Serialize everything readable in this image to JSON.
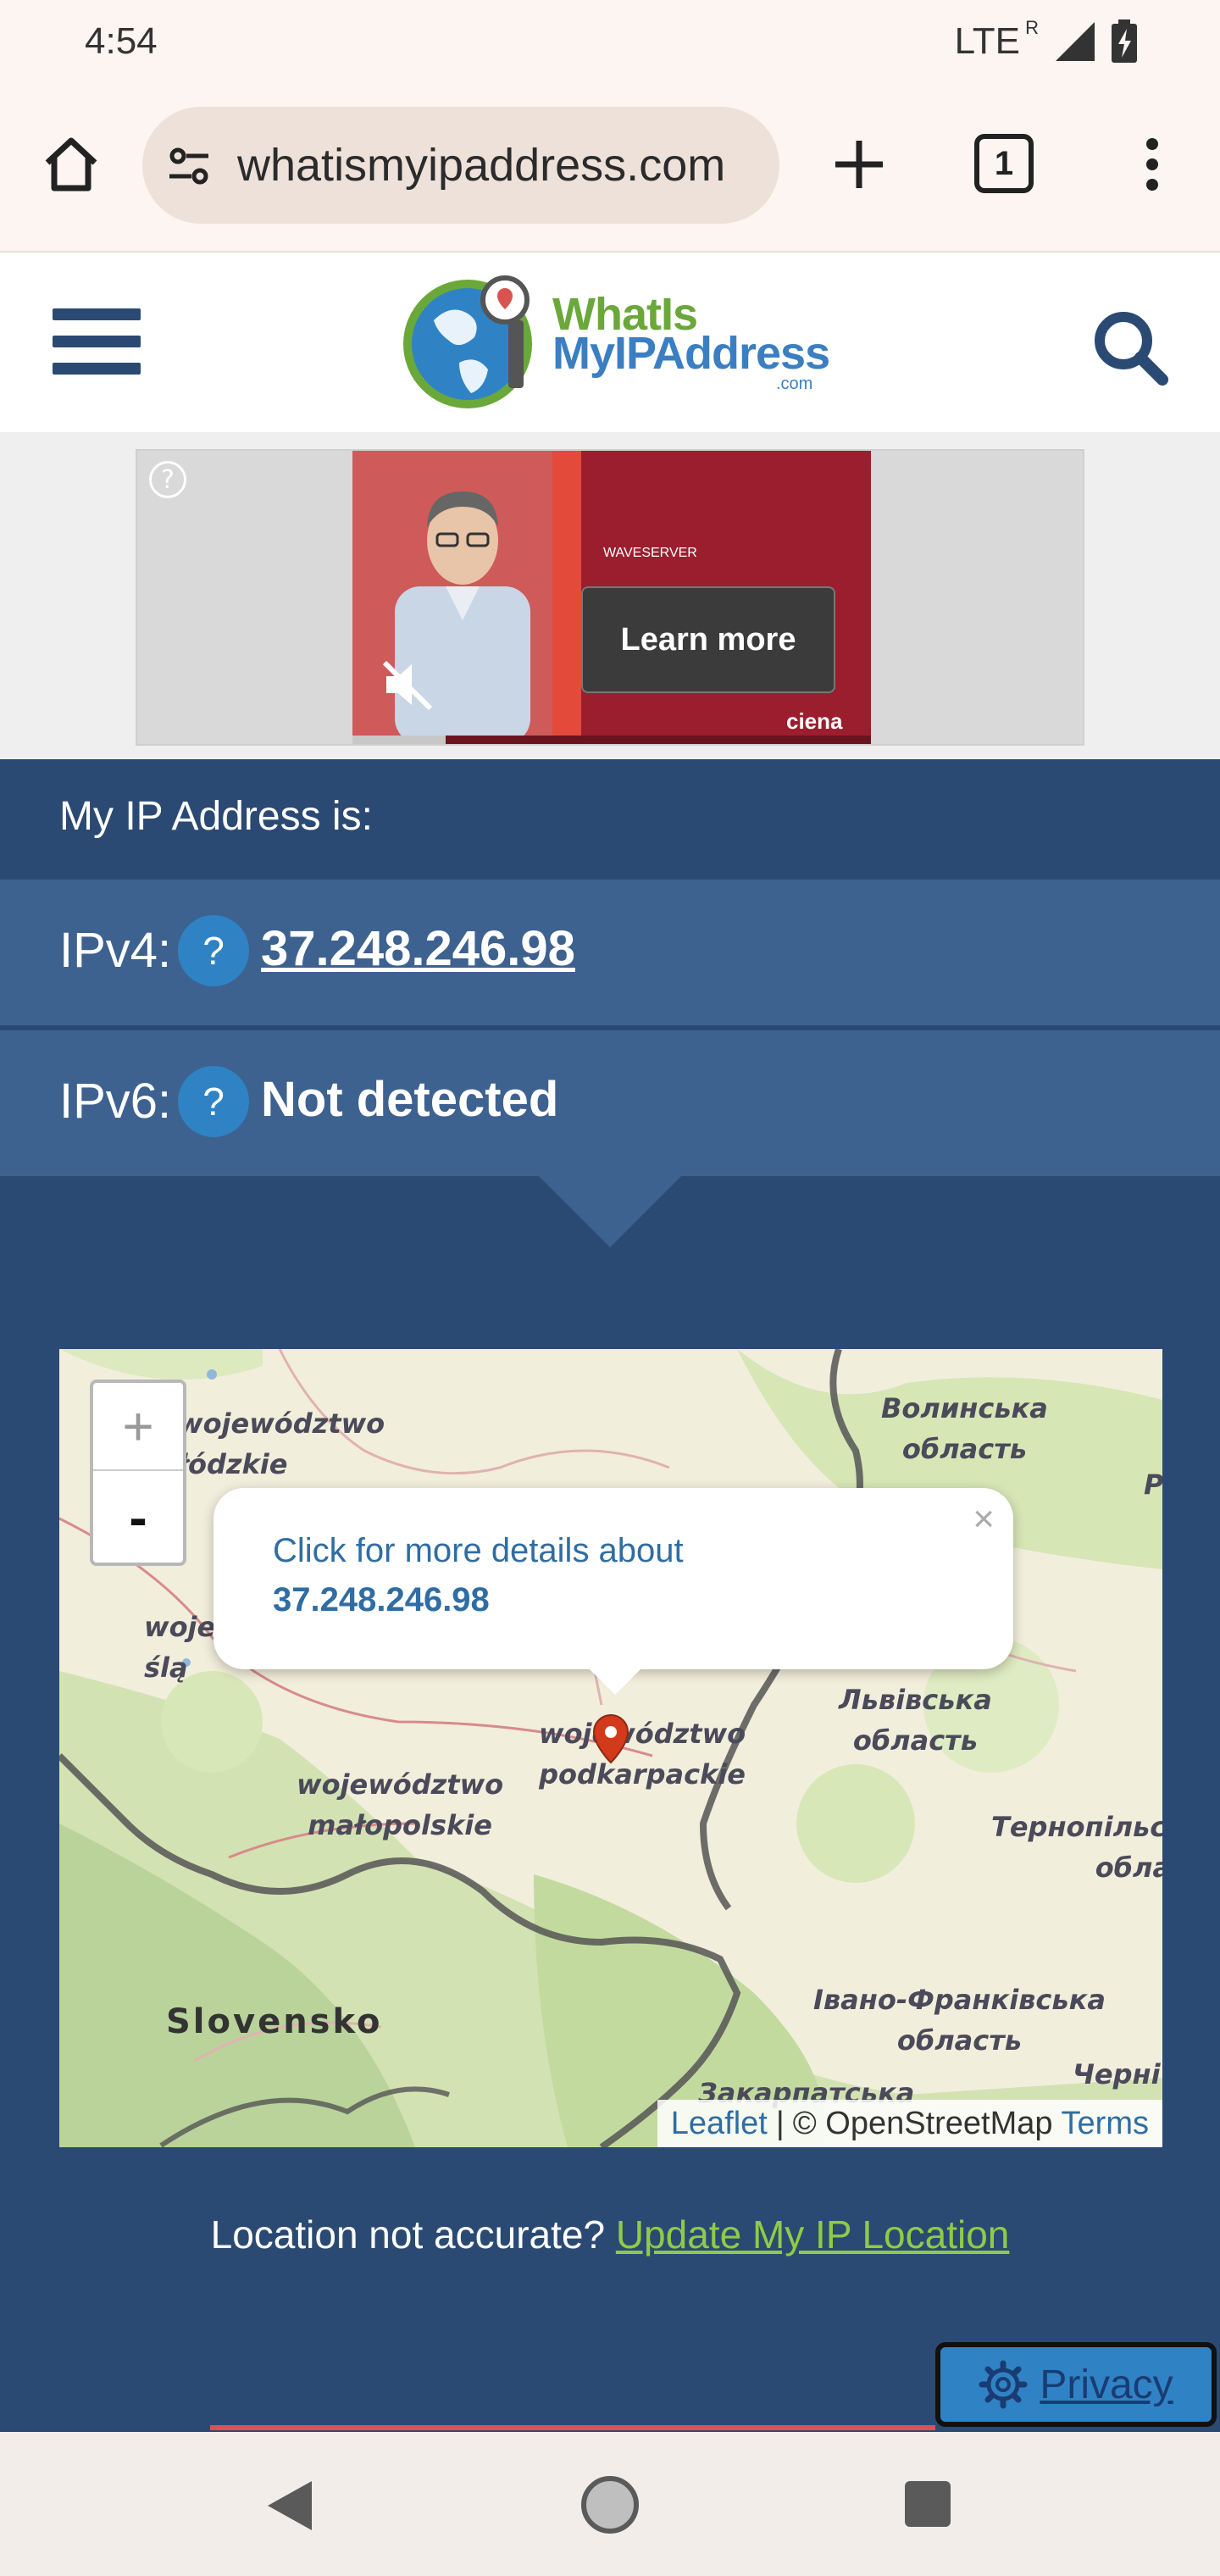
{
  "status_bar": {
    "time": "4:54",
    "network": "LTE",
    "roaming": "R",
    "icons": [
      "signal-icon",
      "battery-charging-icon"
    ]
  },
  "browser": {
    "url": "whatismyipaddress.com",
    "tab_count": "1",
    "icons": [
      "home-icon",
      "site-settings-icon",
      "new-tab-icon",
      "tab-switcher-icon",
      "overflow-menu-icon"
    ]
  },
  "site": {
    "logo_line1": "WhatIs",
    "logo_line2": "MyIPAddress",
    "logo_line3": ".com"
  },
  "ad": {
    "info_symbol": "?",
    "brand_line": "WAVESERVER",
    "cta": "Learn more",
    "advertiser": "ciena",
    "progress": 0.18
  },
  "ip": {
    "title": "My IP Address is:",
    "ipv4_label": "IPv4:",
    "ipv4_value": "37.248.246.98",
    "ipv6_label": "IPv6:",
    "ipv6_value": "Not detected",
    "help_symbol": "?"
  },
  "map": {
    "zoom_in": "+",
    "zoom_out": "-",
    "popup_line1": "Click for more details about",
    "popup_line2": "37.248.246.98",
    "popup_close": "×",
    "labels": {
      "lodzkie": "województwo\nłódzkie",
      "volyn": "Волинська\nобласть",
      "lviv": "Львівська\nобласть",
      "podkarpackie": "województwo\npodkarpackie",
      "malopolskie": "województwo\nmałopolskie",
      "ternopil": "Тернопільська\nобласть",
      "slovensko": "Slovensko",
      "ivano": "Івано-Франківська\nобласть",
      "zakarpattia": "Закарпатська",
      "chernivtsi": "Черні",
      "wojew_partial": "wojew\nślą",
      "p_partial": "Р"
    },
    "attribution_leaflet": "Leaflet",
    "attribution_sep": "|",
    "attribution_osm": "© OpenStreetMap",
    "attribution_terms": "Terms"
  },
  "location": {
    "question": "Location not accurate?",
    "link": "Update My IP Location"
  },
  "privacy": {
    "label": "Privacy"
  },
  "colors": {
    "brand_navy": "#2b4a73",
    "row_blue": "#3d6290",
    "help_blue": "#2f83c5",
    "link_green": "#8fcb46"
  }
}
